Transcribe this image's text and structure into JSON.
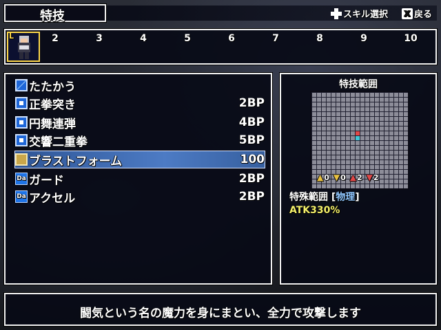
{
  "header": {
    "title": "特技",
    "hint_skill": "スキル選択",
    "hint_back": "戻る",
    "back_key": "X"
  },
  "party": {
    "leader_badge": "L",
    "slots": [
      "2",
      "3",
      "4",
      "5",
      "6",
      "7",
      "8",
      "9",
      "10"
    ]
  },
  "skills": [
    {
      "icon": "slash-icon",
      "name": "たたかう",
      "cost": ""
    },
    {
      "icon": "blue-square-icon",
      "name": "正拳突き",
      "cost": "2BP"
    },
    {
      "icon": "blue-square-icon",
      "name": "円舞連弾",
      "cost": "4BP"
    },
    {
      "icon": "blue-square-icon",
      "name": "交響二重拳",
      "cost": "5BP"
    },
    {
      "icon": "gold-icon",
      "name": "ブラストフォーム",
      "cost": "100"
    },
    {
      "icon": "da-icon",
      "name": "ガード",
      "cost": "2BP"
    },
    {
      "icon": "da-icon",
      "name": "アクセル",
      "cost": "2BP"
    }
  ],
  "da_label": "Da",
  "range_panel": {
    "title": "特技範囲",
    "arrows": [
      {
        "dir": "up",
        "value": "0",
        "color": "#e8c040"
      },
      {
        "dir": "down",
        "value": "0",
        "color": "#e8c040"
      },
      {
        "dir": "up",
        "value": "2",
        "color": "#e04848"
      },
      {
        "dir": "down",
        "value": "2",
        "color": "#e04848"
      }
    ],
    "range_label": "特殊範囲",
    "range_bracket_open": "[",
    "range_bracket_close": "]",
    "damage_type": "物理",
    "atk": "ATK330%",
    "colors": {
      "target": "#e04848",
      "self": "#40c8d8"
    }
  },
  "description": "闘気という名の魔力を身にまとい、全力で攻撃します"
}
